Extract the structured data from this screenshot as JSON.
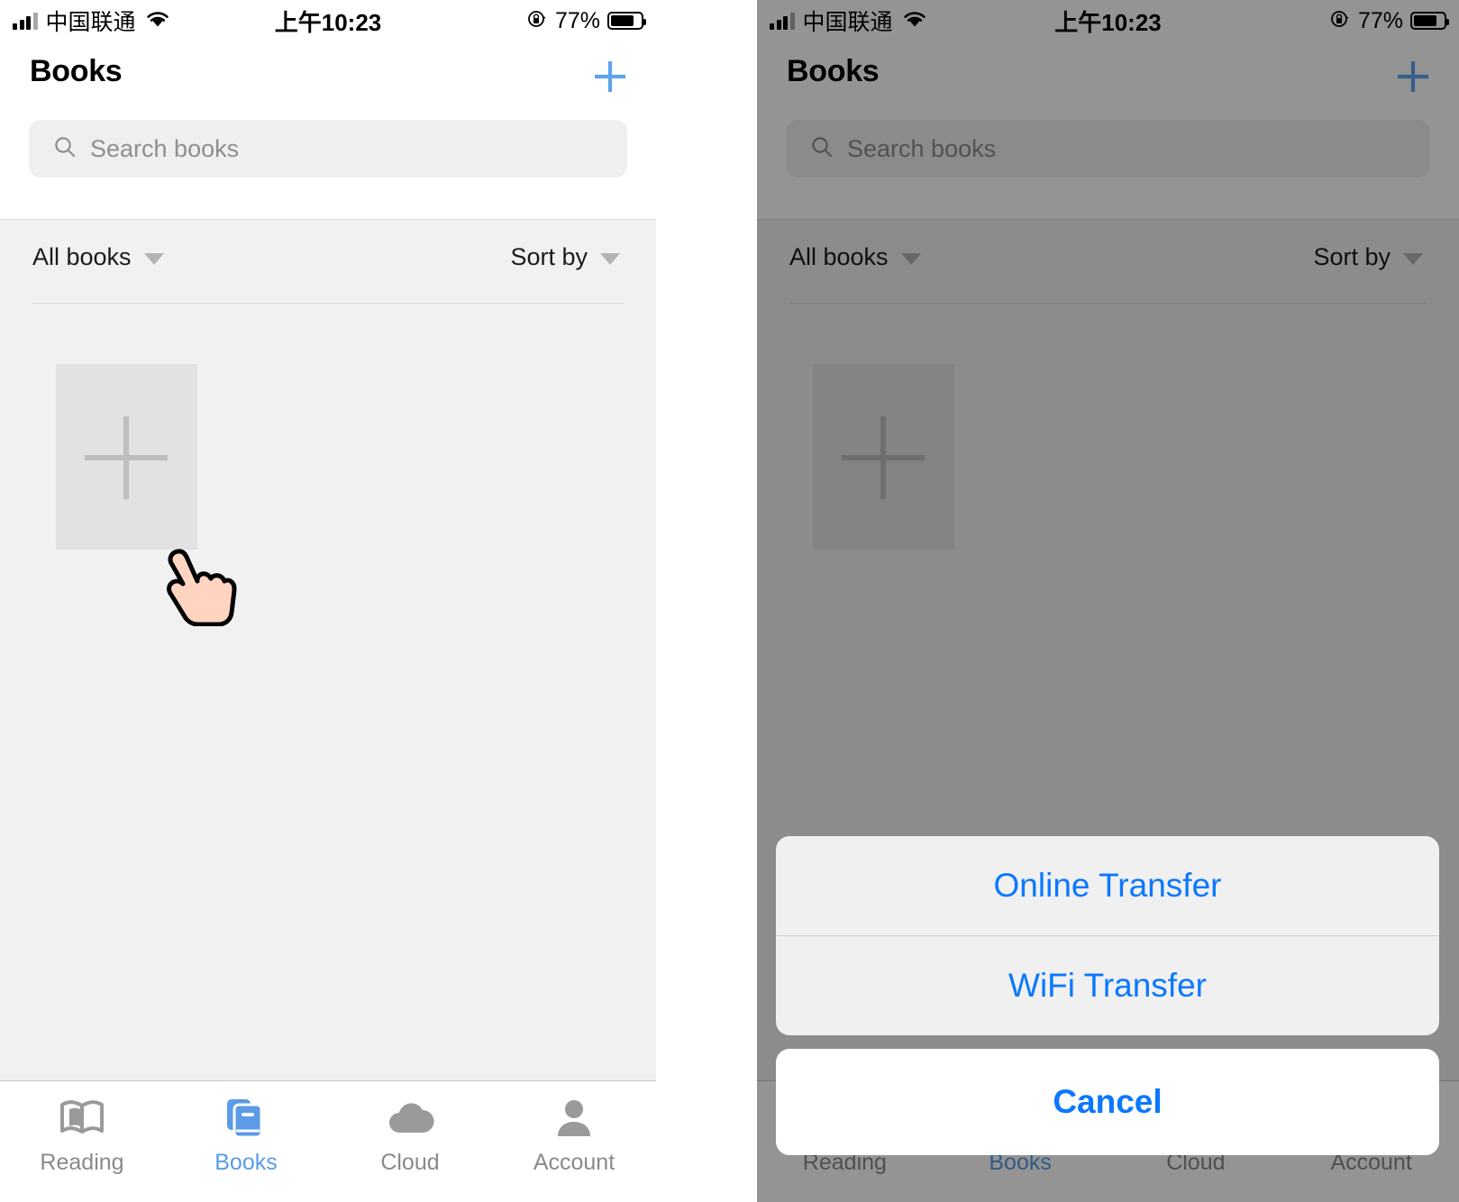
{
  "status_bar": {
    "carrier": "中国联通",
    "wifi_icon": "wifi-icon",
    "time": "上午10:23",
    "rotation_lock_icon": "rotation-lock-icon",
    "battery_percent": "77%",
    "battery_level": 77
  },
  "nav": {
    "title": "Books",
    "add_icon": "plus-icon"
  },
  "search": {
    "icon": "search-icon",
    "placeholder": "Search books",
    "value": ""
  },
  "filter": {
    "books_filter_label": "All books",
    "sort_label": "Sort by",
    "caret_icon": "chevron-down-icon"
  },
  "grid": {
    "add_book_label": "",
    "add_book_icon": "plus-icon"
  },
  "cursor": {
    "icon": "hand-pointer-cursor",
    "fill_color": "#FFD5C2"
  },
  "tabbar": {
    "items": [
      {
        "label": "Reading",
        "icon": "open-book-icon",
        "active": false
      },
      {
        "label": "Books",
        "icon": "books-icon",
        "active": true
      },
      {
        "label": "Cloud",
        "icon": "cloud-icon",
        "active": false
      },
      {
        "label": "Account",
        "icon": "person-icon",
        "active": false
      }
    ]
  },
  "action_sheet": {
    "options": [
      {
        "label": "Online Transfer"
      },
      {
        "label": "WiFi Transfer"
      }
    ],
    "cancel_label": "Cancel"
  },
  "colors": {
    "accent_blue": "#5B9BE8",
    "sheet_blue": "#0A78FF",
    "tab_inactive": "#8A8A8A",
    "content_bg": "#F1F1F1",
    "search_bg": "#EFEFF0",
    "card_bg": "#E2E2E2"
  }
}
